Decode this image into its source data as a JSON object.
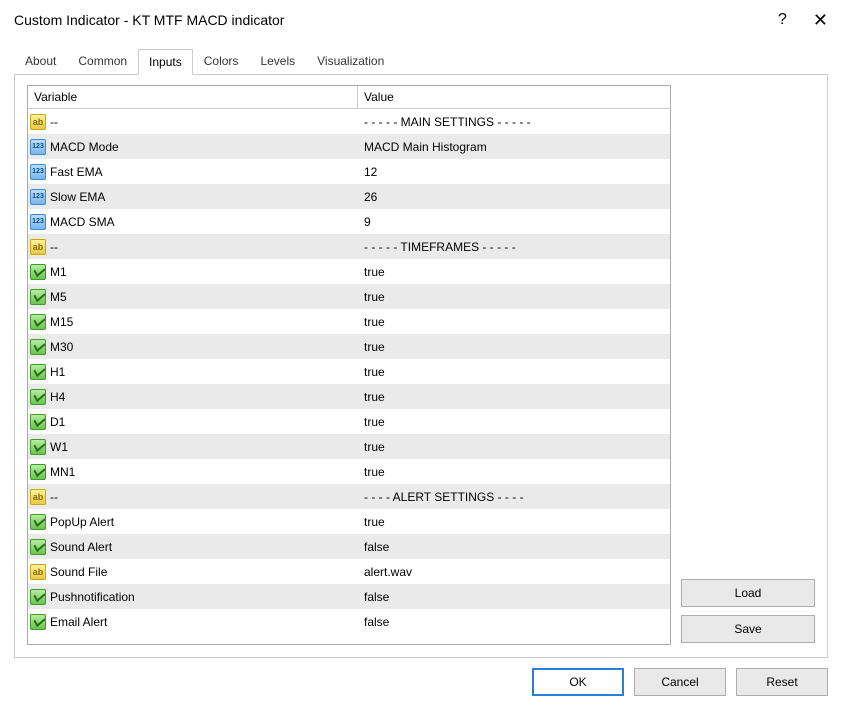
{
  "title": "Custom Indicator - KT MTF MACD indicator",
  "tabs": [
    "About",
    "Common",
    "Inputs",
    "Colors",
    "Levels",
    "Visualization"
  ],
  "activeTab": 2,
  "headers": {
    "variable": "Variable",
    "value": "Value"
  },
  "rows": [
    {
      "icon": "ab",
      "name": "--",
      "value": "- - - - - MAIN SETTINGS - - - - -"
    },
    {
      "icon": "123",
      "name": "MACD Mode",
      "value": "MACD Main Histogram"
    },
    {
      "icon": "123",
      "name": "Fast EMA",
      "value": "12"
    },
    {
      "icon": "123",
      "name": "Slow EMA",
      "value": "26"
    },
    {
      "icon": "123",
      "name": "MACD SMA",
      "value": "9"
    },
    {
      "icon": "ab",
      "name": "--",
      "value": "- - - - - TIMEFRAMES - - - - -"
    },
    {
      "icon": "bool",
      "name": "M1",
      "value": "true"
    },
    {
      "icon": "bool",
      "name": "M5",
      "value": "true"
    },
    {
      "icon": "bool",
      "name": "M15",
      "value": "true"
    },
    {
      "icon": "bool",
      "name": "M30",
      "value": "true"
    },
    {
      "icon": "bool",
      "name": "H1",
      "value": "true"
    },
    {
      "icon": "bool",
      "name": "H4",
      "value": "true"
    },
    {
      "icon": "bool",
      "name": "D1",
      "value": "true"
    },
    {
      "icon": "bool",
      "name": "W1",
      "value": "true"
    },
    {
      "icon": "bool",
      "name": "MN1",
      "value": "true"
    },
    {
      "icon": "ab",
      "name": "--",
      "value": "- - - - ALERT SETTINGS - - - -"
    },
    {
      "icon": "bool",
      "name": "PopUp Alert",
      "value": "true"
    },
    {
      "icon": "bool",
      "name": "Sound Alert",
      "value": "false"
    },
    {
      "icon": "ab",
      "name": "Sound File",
      "value": "alert.wav"
    },
    {
      "icon": "bool",
      "name": "Pushnotification",
      "value": "false"
    },
    {
      "icon": "bool",
      "name": "Email Alert",
      "value": "false"
    }
  ],
  "buttons": {
    "load": "Load",
    "save": "Save",
    "ok": "OK",
    "cancel": "Cancel",
    "reset": "Reset"
  }
}
